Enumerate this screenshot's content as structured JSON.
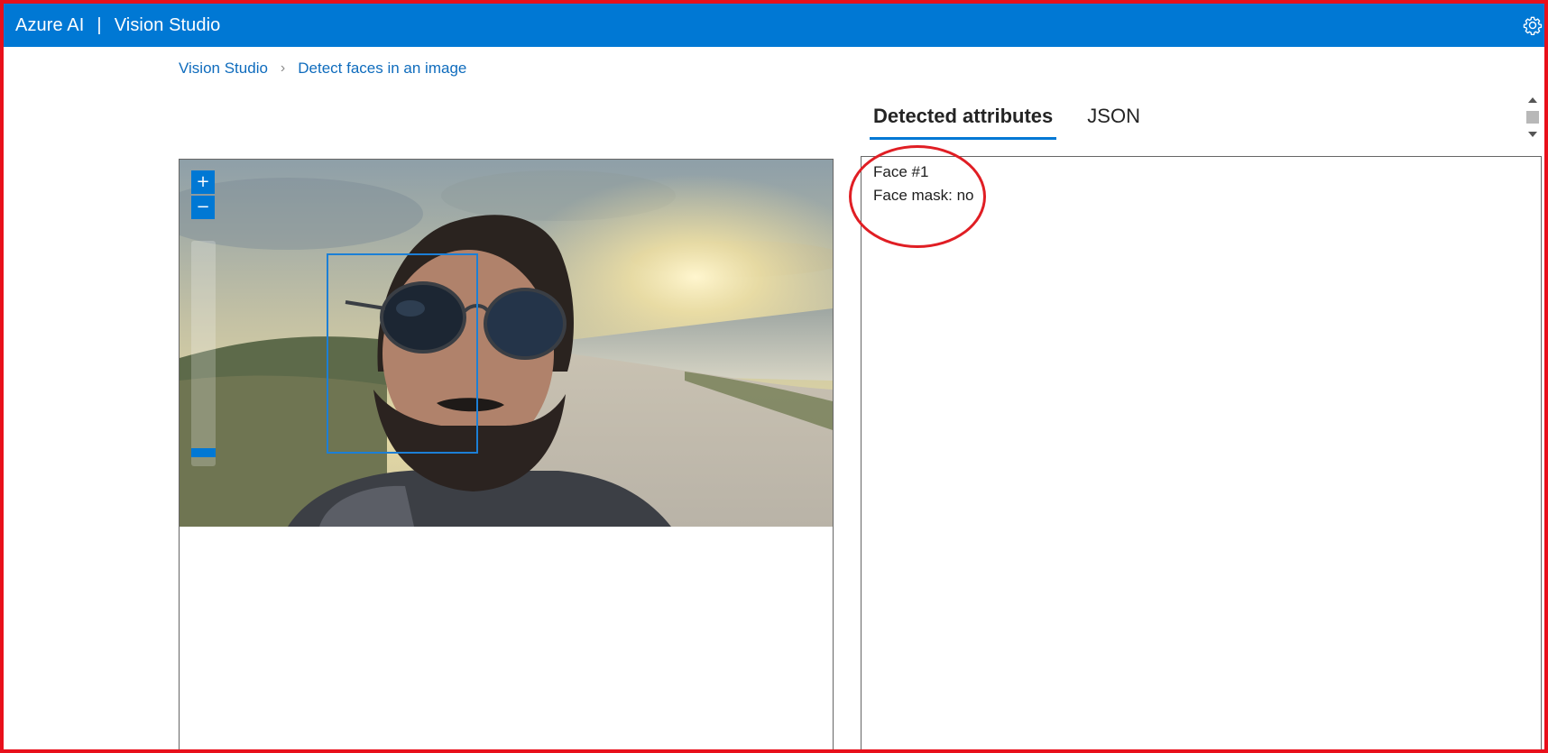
{
  "topbar": {
    "brand": "Azure AI",
    "separator": "|",
    "product": "Vision Studio",
    "bar_color": "#0078d4",
    "settings_icon": "gear-icon"
  },
  "breadcrumb": {
    "home": "Vision Studio",
    "separator": "›",
    "current": "Detect faces in an image"
  },
  "image_viewer": {
    "zoom_in_label": "+",
    "zoom_out_label": "−",
    "faces_detected": 1,
    "image_alt": "Selfie of a bearded man wearing sunglasses on a beach at sunset"
  },
  "tabs": [
    {
      "label": "Detected attributes",
      "active": true
    },
    {
      "label": "JSON",
      "active": false
    }
  ],
  "results": {
    "face_title": "Face #1",
    "face_mask_label": "Face mask: no"
  },
  "colors": {
    "accent": "#0078d4",
    "annotation_red": "#e01e24",
    "frame_red": "#e8101b"
  }
}
